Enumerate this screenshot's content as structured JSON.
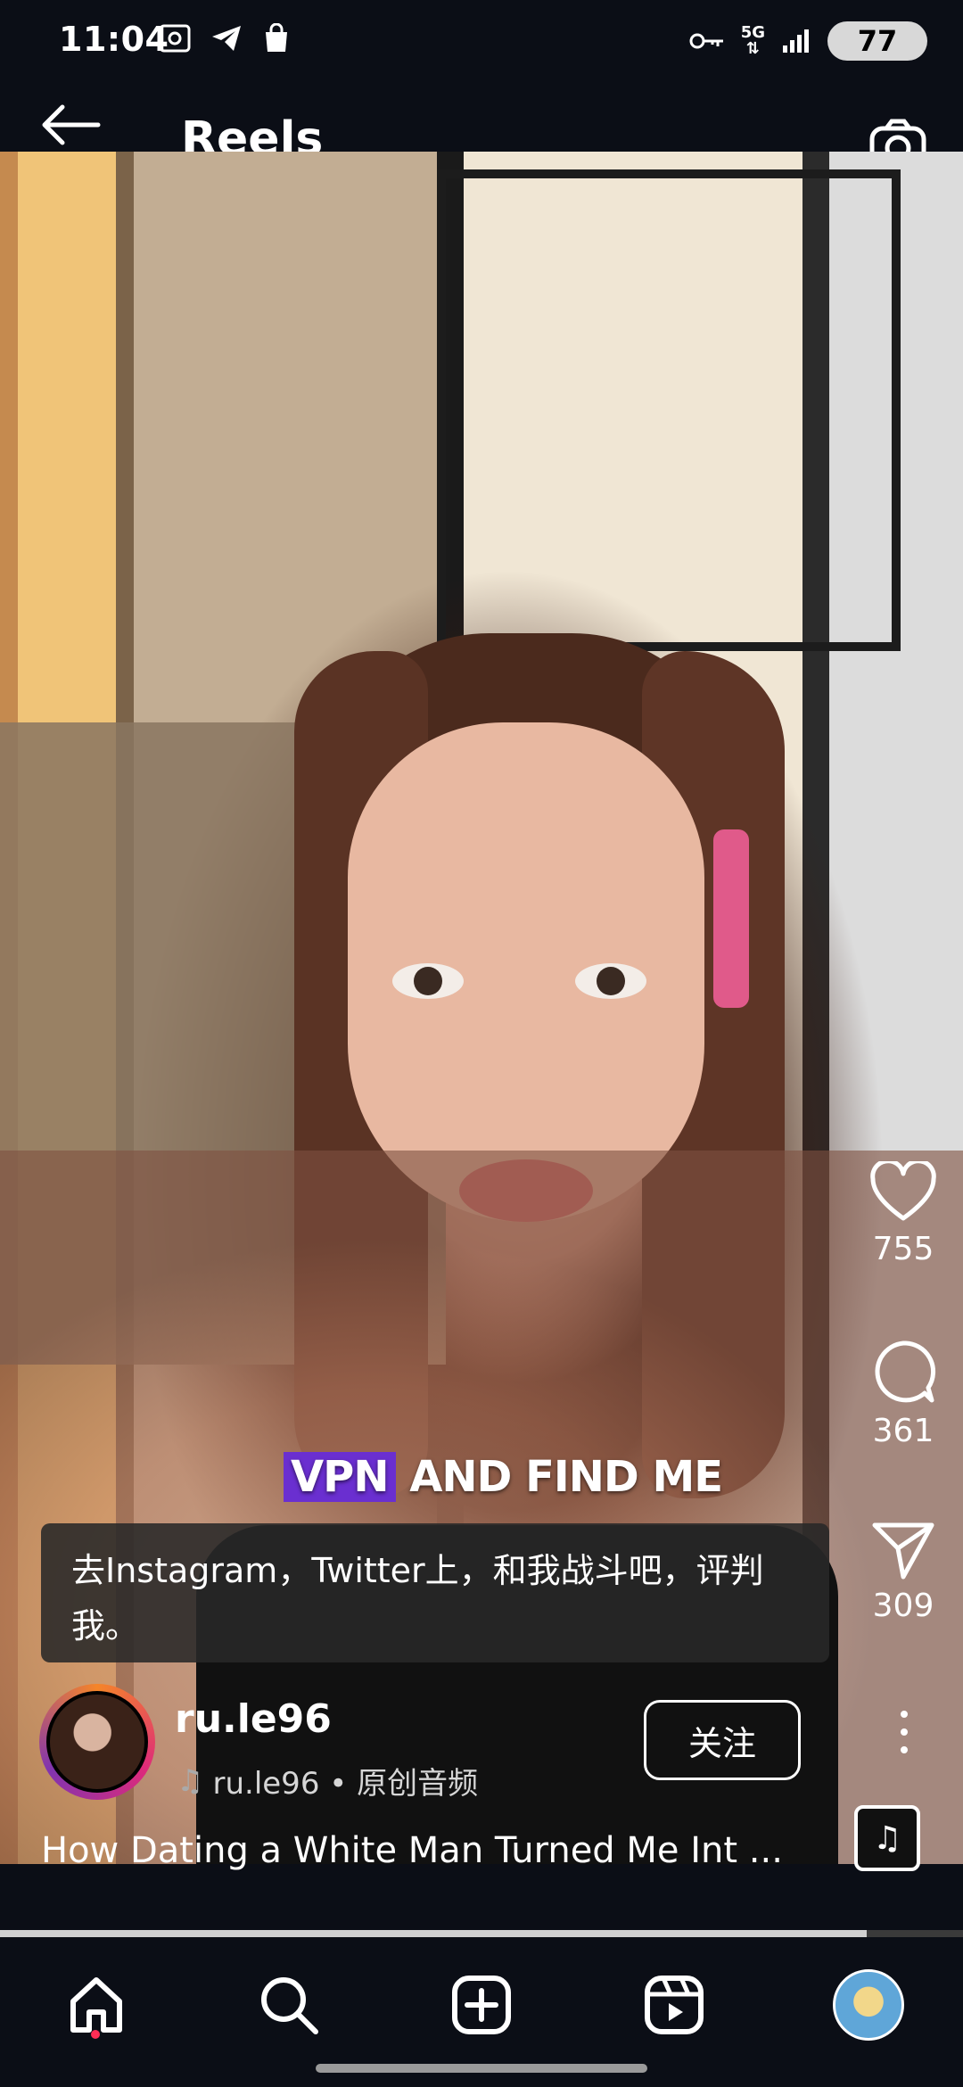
{
  "status_bar": {
    "time": "11:04",
    "network": "5G",
    "battery": "77"
  },
  "header": {
    "title": "Reels"
  },
  "video": {
    "overlay_highlight": "VPN",
    "overlay_rest": " AND FIND ME",
    "subtitle": "去Instagram，Twitter上，和我战斗吧，评判我。"
  },
  "actions": {
    "likes": "755",
    "comments": "361",
    "shares": "309"
  },
  "author": {
    "username": "ru.le96",
    "audio": "ru.le96 • 原创音频",
    "follow_label": "关注"
  },
  "reel": {
    "title": "How Dating a White Man Turned Me Int ...",
    "progress": 0.9
  },
  "nav": {
    "items": [
      "home-icon",
      "search-icon",
      "create-icon",
      "reels-icon",
      "profile-avatar"
    ]
  },
  "colors": {
    "highlight": "#6a2fd0",
    "notification_dot": "#ff2d55"
  }
}
